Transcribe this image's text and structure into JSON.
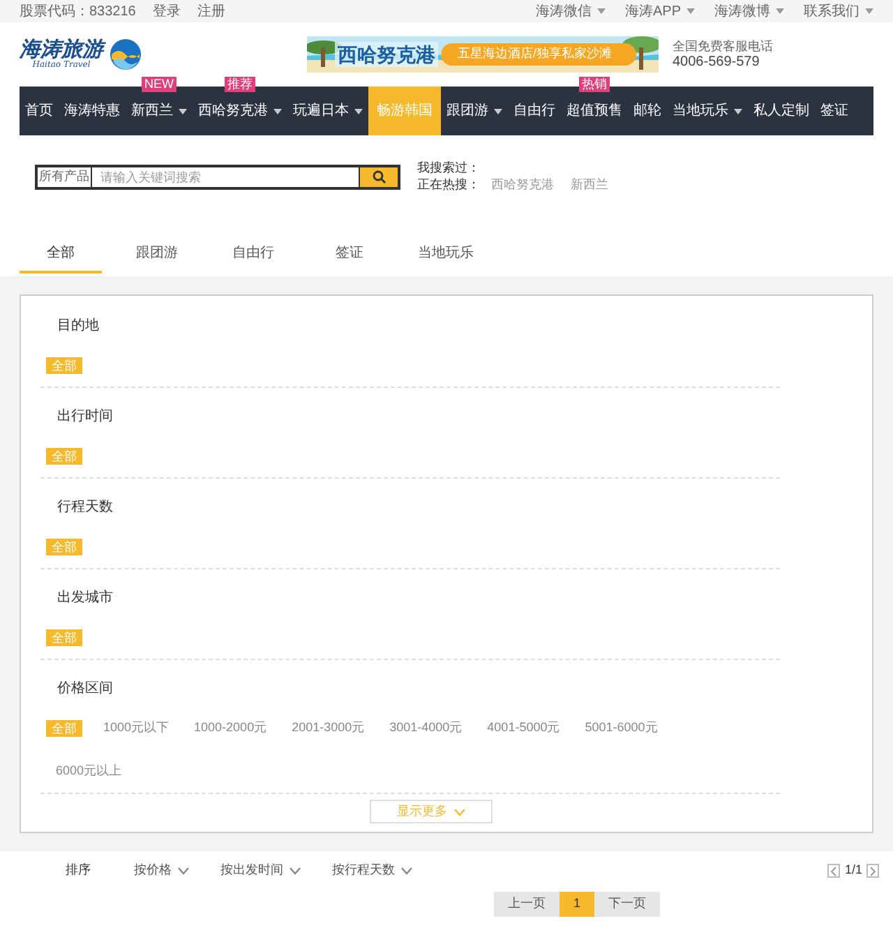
{
  "top_bar": {
    "stock_code": "股票代码：833216",
    "links": [
      "登录",
      "注册"
    ],
    "right_links": [
      {
        "label": "海涛微信",
        "dropdown": true
      },
      {
        "label": "海涛APP",
        "dropdown": true
      },
      {
        "label": "海涛微博",
        "dropdown": true
      },
      {
        "label": "联系我们",
        "dropdown": true
      }
    ]
  },
  "header": {
    "logo_text": "海涛旅游",
    "logo_subtitle": "Haitao Travel",
    "banner": {
      "kind": "picture",
      "title": "西哈努克港",
      "slogan": "五星海边酒店/独享私家沙滩"
    },
    "hotline_label": "全国免费客服电话",
    "hotline": "4006-569-579"
  },
  "nav": [
    {
      "label": "首页",
      "dropdown": false,
      "selected": false
    },
    {
      "label": "海涛特惠",
      "dropdown": false,
      "selected": false
    },
    {
      "label": "新西兰",
      "badge": "NEW",
      "dropdown": true,
      "selected": false
    },
    {
      "label": "西哈努克港",
      "badge": "推荐",
      "dropdown": true,
      "selected": false
    },
    {
      "label": "玩遍日本",
      "dropdown": true,
      "selected": false
    },
    {
      "label": "畅游韩国",
      "dropdown": false,
      "selected": true
    },
    {
      "label": "跟团游",
      "dropdown": true,
      "selected": false
    },
    {
      "label": "自由行",
      "dropdown": false,
      "selected": false
    },
    {
      "label": "超值预售",
      "badge": "热销",
      "dropdown": false,
      "selected": false
    },
    {
      "label": "邮轮",
      "dropdown": false,
      "selected": false
    },
    {
      "label": "当地玩乐",
      "dropdown": true,
      "selected": false
    },
    {
      "label": "私人定制",
      "dropdown": false,
      "selected": false
    },
    {
      "label": "签证",
      "dropdown": false,
      "selected": false
    }
  ],
  "search": {
    "category": "所有产品",
    "placeholder": "请输入关键词搜索",
    "history_label": "我搜索过：",
    "hot_label": "正在热搜：",
    "hot": [
      "西哈努克港",
      "新西兰"
    ]
  },
  "tabs": [
    {
      "label": "全部",
      "selected": true
    },
    {
      "label": "跟团游",
      "selected": false
    },
    {
      "label": "自由行",
      "selected": false
    },
    {
      "label": "签证",
      "selected": false
    },
    {
      "label": "当地玩乐",
      "selected": false
    }
  ],
  "filters": [
    {
      "title": "目的地",
      "options": [
        {
          "label": "全部",
          "selected": true
        }
      ]
    },
    {
      "title": "出行时间",
      "options": [
        {
          "label": "全部",
          "selected": true
        }
      ]
    },
    {
      "title": "行程天数",
      "options": [
        {
          "label": "全部",
          "selected": true
        }
      ]
    },
    {
      "title": "出发城市",
      "options": [
        {
          "label": "全部",
          "selected": true
        }
      ]
    },
    {
      "title": "价格区间",
      "options": [
        {
          "label": "全部",
          "selected": true
        },
        {
          "label": "1000元以下",
          "selected": false
        },
        {
          "label": "1000-2000元",
          "selected": false
        },
        {
          "label": "2001-3000元",
          "selected": false
        },
        {
          "label": "3001-4000元",
          "selected": false
        },
        {
          "label": "4001-5000元",
          "selected": false
        },
        {
          "label": "5001-6000元",
          "selected": false
        },
        {
          "label": "6000元以上",
          "selected": false
        }
      ]
    }
  ],
  "show_more": "显示更多",
  "sort": {
    "label": "排序",
    "options": [
      "按价格",
      "按出发时间",
      "按行程天数"
    ],
    "page_indicator": "1/1"
  },
  "pagination": [
    {
      "label": "上一页",
      "selected": false
    },
    {
      "label": "1",
      "selected": true
    },
    {
      "label": "下一页",
      "selected": false
    }
  ]
}
